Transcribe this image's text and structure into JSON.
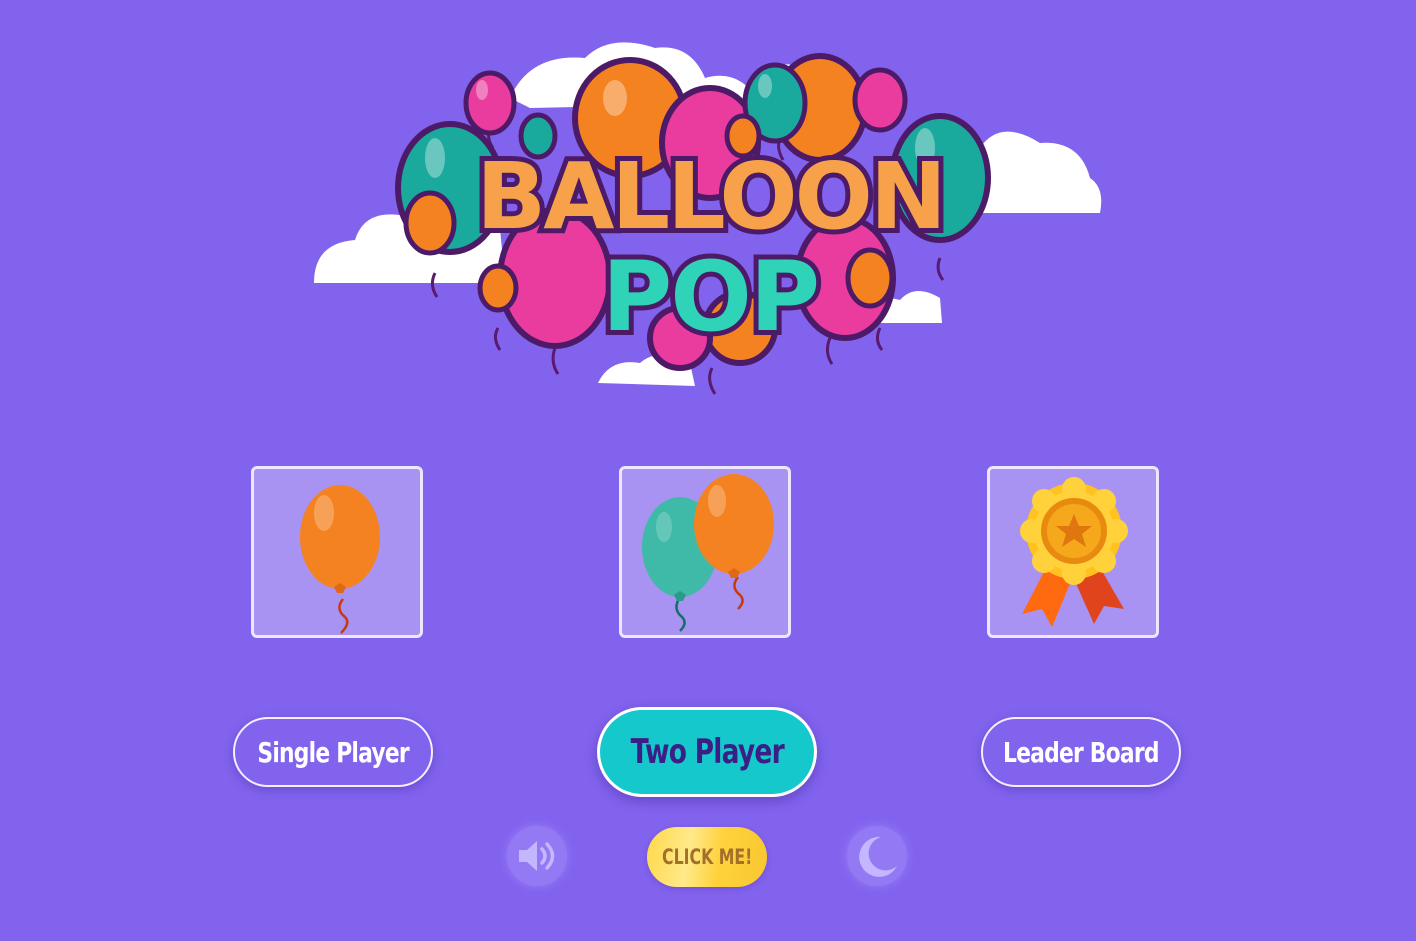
{
  "logo": {
    "line1": "BALLOON",
    "line2": "POP",
    "icon": "balloon-pop-logo"
  },
  "modes": [
    {
      "label": "Single Player",
      "icon": "single-balloon-icon"
    },
    {
      "label": "Two Player",
      "icon": "two-balloons-icon"
    },
    {
      "label": "Leader Board",
      "icon": "award-ribbon-icon"
    }
  ],
  "controls": {
    "sound_icon": "speaker-icon",
    "click_me_label": "CLICK ME!",
    "theme_icon": "moon-icon"
  },
  "colors": {
    "background": "#8263ee",
    "card": "#a893f3",
    "active_button": "#14c8cc",
    "balloon_orange": "#f58220",
    "balloon_teal": "#19b3a6",
    "balloon_pink": "#ee3fa0",
    "gold": "#ffd23c"
  }
}
